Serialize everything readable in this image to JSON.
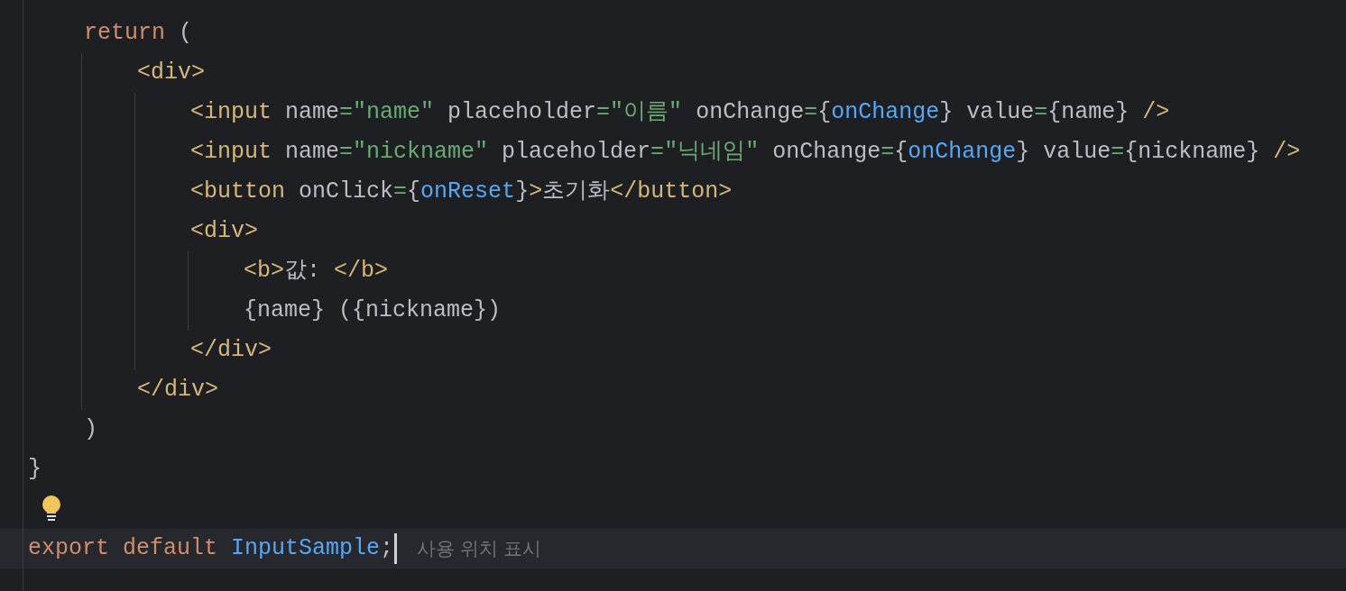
{
  "editor": {
    "function_body": [
      {
        "tokens": [
          {
            "kind": "keyword",
            "text": "return"
          },
          {
            "kind": "text",
            "text": " ("
          }
        ],
        "children": [
          {
            "tokens": [
              {
                "kind": "tag",
                "text": "<div>"
              }
            ],
            "children": [
              {
                "tokens": [
                  {
                    "kind": "tag",
                    "text": "<input"
                  },
                  {
                    "kind": "text",
                    "text": " name"
                  },
                  {
                    "kind": "eq",
                    "text": "="
                  },
                  {
                    "kind": "string",
                    "text": "\"name\""
                  },
                  {
                    "kind": "text",
                    "text": " placeholder"
                  },
                  {
                    "kind": "eq",
                    "text": "="
                  },
                  {
                    "kind": "string",
                    "text": "\"이름\""
                  },
                  {
                    "kind": "text",
                    "text": " onChange"
                  },
                  {
                    "kind": "eq",
                    "text": "="
                  },
                  {
                    "kind": "text",
                    "text": "{"
                  },
                  {
                    "kind": "ref",
                    "text": "onChange"
                  },
                  {
                    "kind": "text",
                    "text": "} value"
                  },
                  {
                    "kind": "eq",
                    "text": "="
                  },
                  {
                    "kind": "text",
                    "text": "{name} "
                  },
                  {
                    "kind": "tag",
                    "text": "/>"
                  }
                ]
              },
              {
                "tokens": [
                  {
                    "kind": "tag",
                    "text": "<input"
                  },
                  {
                    "kind": "text",
                    "text": " name"
                  },
                  {
                    "kind": "eq",
                    "text": "="
                  },
                  {
                    "kind": "string",
                    "text": "\"nickname\""
                  },
                  {
                    "kind": "text",
                    "text": " placeholder"
                  },
                  {
                    "kind": "eq",
                    "text": "="
                  },
                  {
                    "kind": "string",
                    "text": "\"닉네임\""
                  },
                  {
                    "kind": "text",
                    "text": " onChange"
                  },
                  {
                    "kind": "eq",
                    "text": "="
                  },
                  {
                    "kind": "text",
                    "text": "{"
                  },
                  {
                    "kind": "ref",
                    "text": "onChange"
                  },
                  {
                    "kind": "text",
                    "text": "} value"
                  },
                  {
                    "kind": "eq",
                    "text": "="
                  },
                  {
                    "kind": "text",
                    "text": "{nickname} "
                  },
                  {
                    "kind": "tag",
                    "text": "/>"
                  }
                ]
              },
              {
                "tokens": [
                  {
                    "kind": "tag",
                    "text": "<button"
                  },
                  {
                    "kind": "text",
                    "text": " onClick"
                  },
                  {
                    "kind": "eq",
                    "text": "="
                  },
                  {
                    "kind": "text",
                    "text": "{"
                  },
                  {
                    "kind": "ref",
                    "text": "onReset"
                  },
                  {
                    "kind": "text",
                    "text": "}"
                  },
                  {
                    "kind": "tag",
                    "text": ">"
                  },
                  {
                    "kind": "text",
                    "text": "초기화"
                  },
                  {
                    "kind": "tag",
                    "text": "</button>"
                  }
                ]
              },
              {
                "tokens": [
                  {
                    "kind": "tag",
                    "text": "<div>"
                  }
                ],
                "children": [
                  {
                    "tokens": [
                      {
                        "kind": "tag",
                        "text": "<b>"
                      },
                      {
                        "kind": "text",
                        "text": "값: "
                      },
                      {
                        "kind": "tag",
                        "text": "</b>"
                      }
                    ]
                  },
                  {
                    "tokens": [
                      {
                        "kind": "text",
                        "text": "{name} ({nickname})"
                      }
                    ]
                  }
                ]
              },
              {
                "tokens": [
                  {
                    "kind": "tag",
                    "text": "</div>"
                  }
                ]
              }
            ]
          },
          {
            "tokens": [
              {
                "kind": "tag",
                "text": "</div>"
              }
            ]
          }
        ]
      },
      {
        "tokens": [
          {
            "kind": "text",
            "text": ")"
          }
        ]
      }
    ],
    "lines_after": [
      {
        "tokens": [
          {
            "kind": "text",
            "text": "}"
          }
        ]
      },
      {
        "kind": "lightbulb"
      },
      {
        "tokens": [
          {
            "kind": "keyword",
            "text": "export default "
          },
          {
            "kind": "ref",
            "text": "InputSample"
          },
          {
            "kind": "text",
            "text": ";"
          }
        ],
        "current": true,
        "hint": "사용 위치 표시"
      }
    ]
  }
}
